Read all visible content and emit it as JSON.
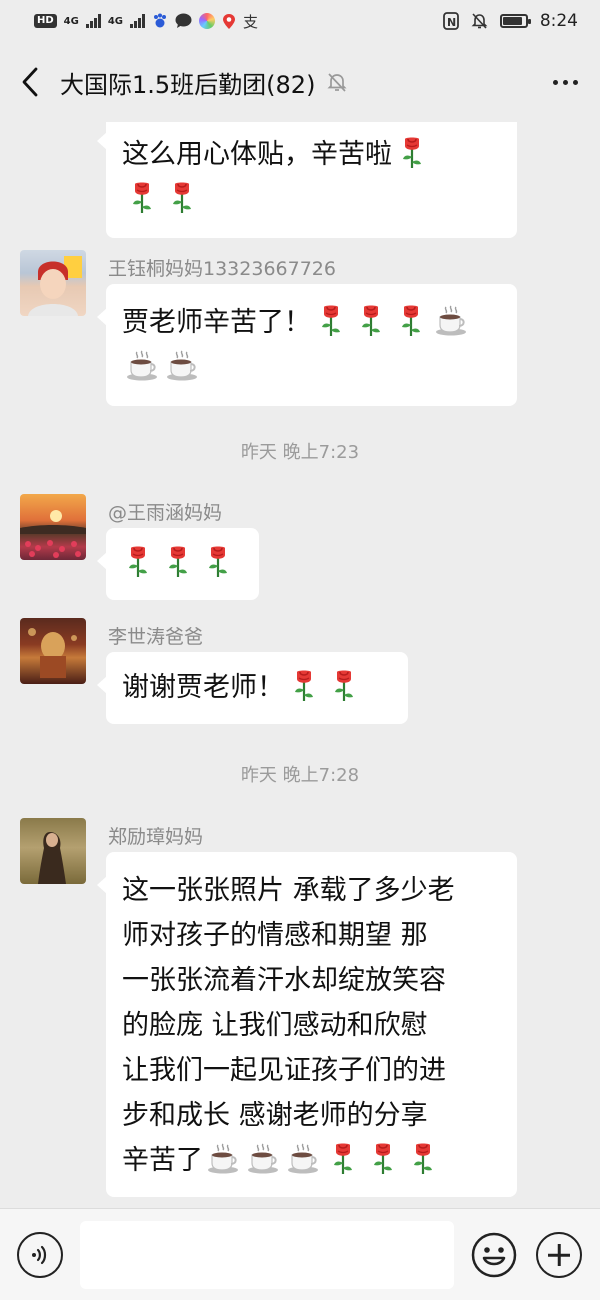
{
  "status_bar": {
    "hd": "HD",
    "net1": "4G",
    "net2": "4G",
    "time": "8:24",
    "battery_level": 0.85,
    "icons": [
      "baidu-icon",
      "chat-bubble-icon",
      "colorful-app-icon",
      "location-pin-icon",
      "alipay-icon",
      "nfc-icon",
      "bell-off-icon"
    ]
  },
  "header": {
    "title": "大国际1.5班后勤团(82)",
    "icons": {
      "back": "chevron-left-icon",
      "mute": "bell-slash-icon",
      "more": "more-dots-icon"
    }
  },
  "emoji_names": {
    "rose": "rose-icon",
    "coffee": "coffee-icon"
  },
  "messages": [
    {
      "text": "这么用心体贴，辛苦啦",
      "emoji_line1": [
        "rose"
      ],
      "emoji_line2": [
        "rose",
        "rose"
      ]
    },
    {
      "sender": "王钰桐妈妈13323667726",
      "text": "贾老师辛苦了！",
      "emoji_line1": [
        "rose",
        "rose",
        "rose",
        "coffee"
      ],
      "emoji_line2": [
        "coffee",
        "coffee"
      ]
    },
    {
      "sender": "@王雨涵妈妈",
      "emoji_line1": [
        "rose",
        "rose",
        "rose"
      ]
    },
    {
      "sender": "李世涛爸爸",
      "text": "谢谢贾老师！",
      "emoji_line1": [
        "rose",
        "rose"
      ]
    },
    {
      "sender": "郑励璋妈妈",
      "lines": [
        "这一张张照片 承载了多少老",
        "师对孩子的情感和期望  那",
        "一张张流着汗水却绽放笑容",
        "的脸庞 让我们感动和欣慰",
        "让我们一起见证孩子们的进",
        "步和成长 感谢老师的分享",
        "辛苦了"
      ],
      "emoji_last": [
        "coffee",
        "coffee",
        "coffee",
        "rose",
        "rose",
        "rose"
      ]
    }
  ],
  "time_dividers": [
    "昨天 晚上7:23",
    "昨天 晚上7:28"
  ],
  "input": {
    "value": "",
    "placeholder": ""
  },
  "colors": {
    "background": "#ededed",
    "bubble": "#ffffff",
    "meta_text": "#8a8a8a"
  }
}
